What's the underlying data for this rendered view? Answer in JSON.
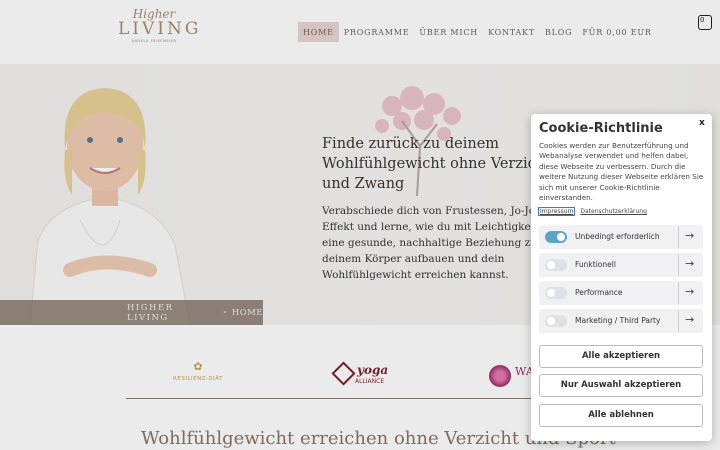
{
  "header": {
    "logo": {
      "script": "Higher",
      "main": "LIVING",
      "sub": "ANGELA FRISEMEIER"
    },
    "nav": [
      "HOME",
      "PROGRAMME",
      "ÜBER MICH",
      "KONTAKT",
      "BLOG",
      "FÜR 0,00 EUR"
    ],
    "active_nav": "HOME",
    "cart_count": "0"
  },
  "hero": {
    "title": "Finde zurück zu deinem Wohlfühlgewicht ohne Verzicht und Zwang",
    "text": "Verabschiede dich von Frustessen, Jo-Jo-Effekt und lerne, wie du mit Leichtigkeit eine gesunde, nachhaltige Beziehung zu deinem Körper aufbauen und dein Wohlfühlgewicht erreichen kannst.",
    "breadcrumb": {
      "brand": "HIGHER LIVING",
      "home": "HOME"
    }
  },
  "partners": {
    "resilienz": "RESILIENZ-DIÄT",
    "yoga_main": "yoga",
    "yoga_sub": "ALLIANCE",
    "wa": "WA"
  },
  "section_title": "Wohlfühlgewicht erreichen ohne Verzicht und Sport",
  "cookie": {
    "close": "x",
    "title": "Cookie-Richtlinie",
    "text": "Cookies werden zur Benutzerführung und Webanalyse verwendet und helfen dabei, diese Webseite zu verbessern. Durch die weitere Nutzung dieser Webseite erklären Sie sich mit unserer Cookie-Richtlinie einverstanden.",
    "links": {
      "impressum": "Impressum",
      "datenschutz": "Datenschutzerklärung"
    },
    "categories": [
      {
        "label": "Unbedingt erforderlich",
        "enabled": true
      },
      {
        "label": "Funktionell",
        "enabled": false
      },
      {
        "label": "Performance",
        "enabled": false
      },
      {
        "label": "Marketing / Third Party",
        "enabled": false
      }
    ],
    "buttons": {
      "accept_all": "Alle akzeptieren",
      "accept_selection": "Nur Auswahl akzeptieren",
      "reject_all": "Alle ablehnen"
    }
  }
}
